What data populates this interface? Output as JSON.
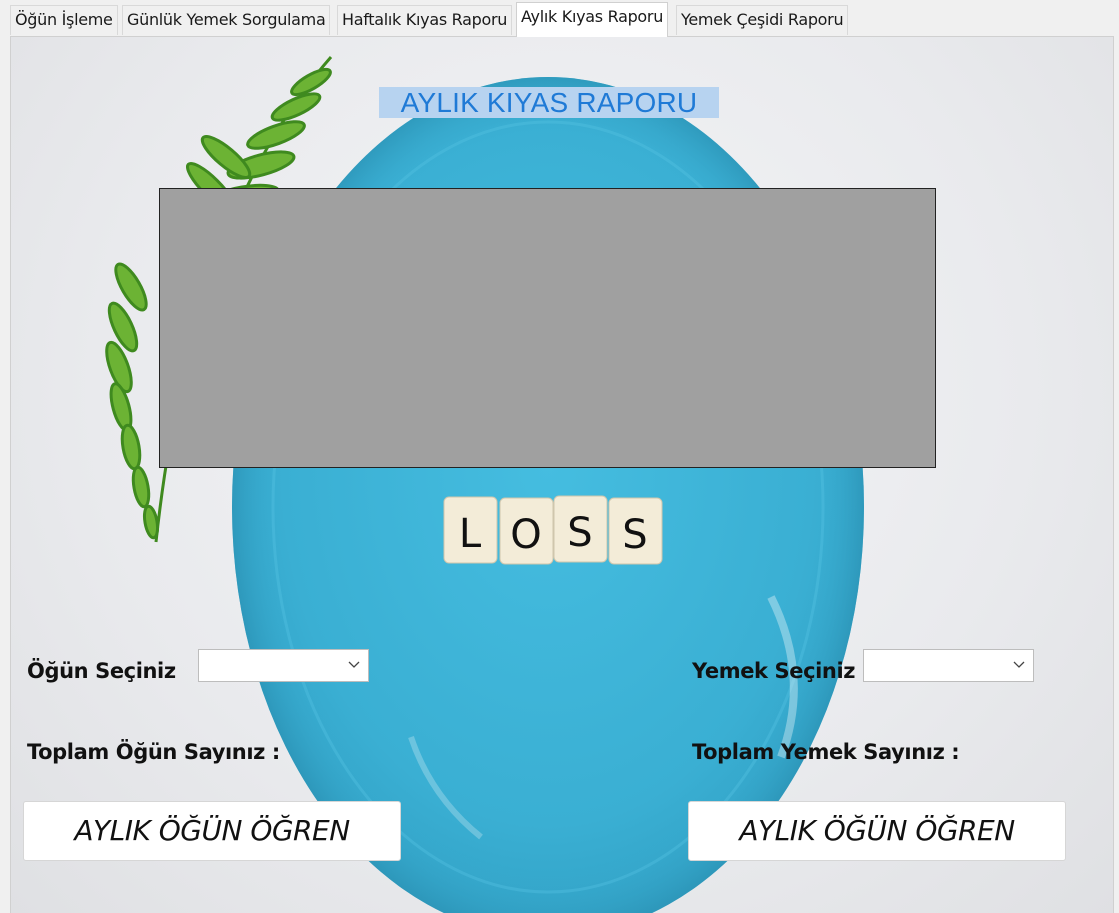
{
  "tabs": [
    {
      "label": "Öğün İşleme",
      "active": false
    },
    {
      "label": "Günlük Yemek Sorgulama",
      "active": false
    },
    {
      "label": "Haftalık Kıyas Raporu",
      "active": false
    },
    {
      "label": "Aylık Kıyas Raporu",
      "active": true
    },
    {
      "label": "Yemek Çeşidi Raporu",
      "active": false
    }
  ],
  "page": {
    "title": "AYLIK KIYAS RAPORU",
    "background_tiles": [
      "L",
      "O",
      "S",
      "S"
    ]
  },
  "left": {
    "meal_label": "Öğün Seçiniz",
    "meal_selected": "",
    "total_label": "Toplam Öğün Sayınız :",
    "button_label": "AYLIK ÖĞÜN ÖĞREN"
  },
  "right": {
    "food_label": "Yemek Seçiniz",
    "food_selected": "",
    "total_label": "Toplam Yemek Sayınız :",
    "button_label": "AYLIK ÖĞÜN ÖĞREN"
  },
  "colors": {
    "title_text": "#1f7ad6",
    "title_highlight": "#b7d3f0",
    "chart_placeholder": "#a0a0a0",
    "plate": "#3fb4d6"
  },
  "icons": {
    "combo_arrow": "chevron-down-icon"
  }
}
